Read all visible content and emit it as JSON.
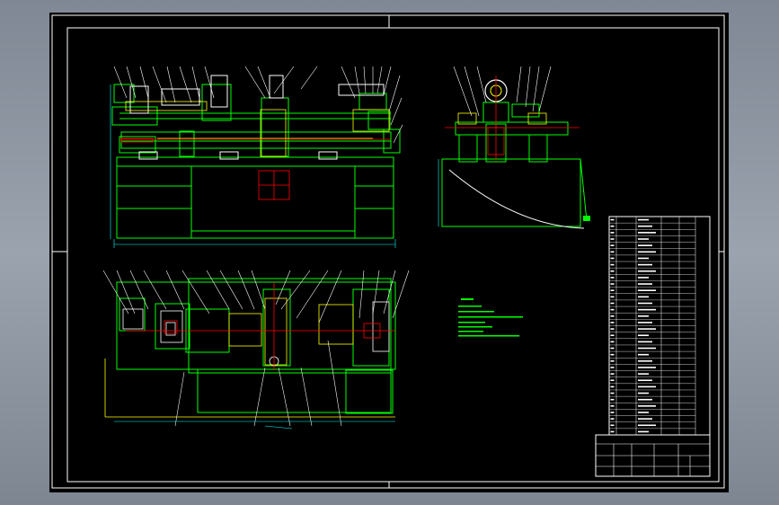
{
  "viewport": {
    "background_color": "#8e97a2",
    "sheet_color": "#000000"
  },
  "colors": {
    "border": "#ffffff",
    "outline": "#00ff00",
    "hidden_line": "#ffff00",
    "center_line": "#ff0000",
    "dimension": "#00ffff",
    "part": "#ffffff"
  },
  "parts_table": {
    "rows": 34,
    "columns": 6
  },
  "title_block": {
    "title": "",
    "drawing_no": ""
  },
  "technical_notes": {
    "heading": "",
    "lines": []
  },
  "views": [
    "front-view",
    "side-view",
    "top-view"
  ]
}
